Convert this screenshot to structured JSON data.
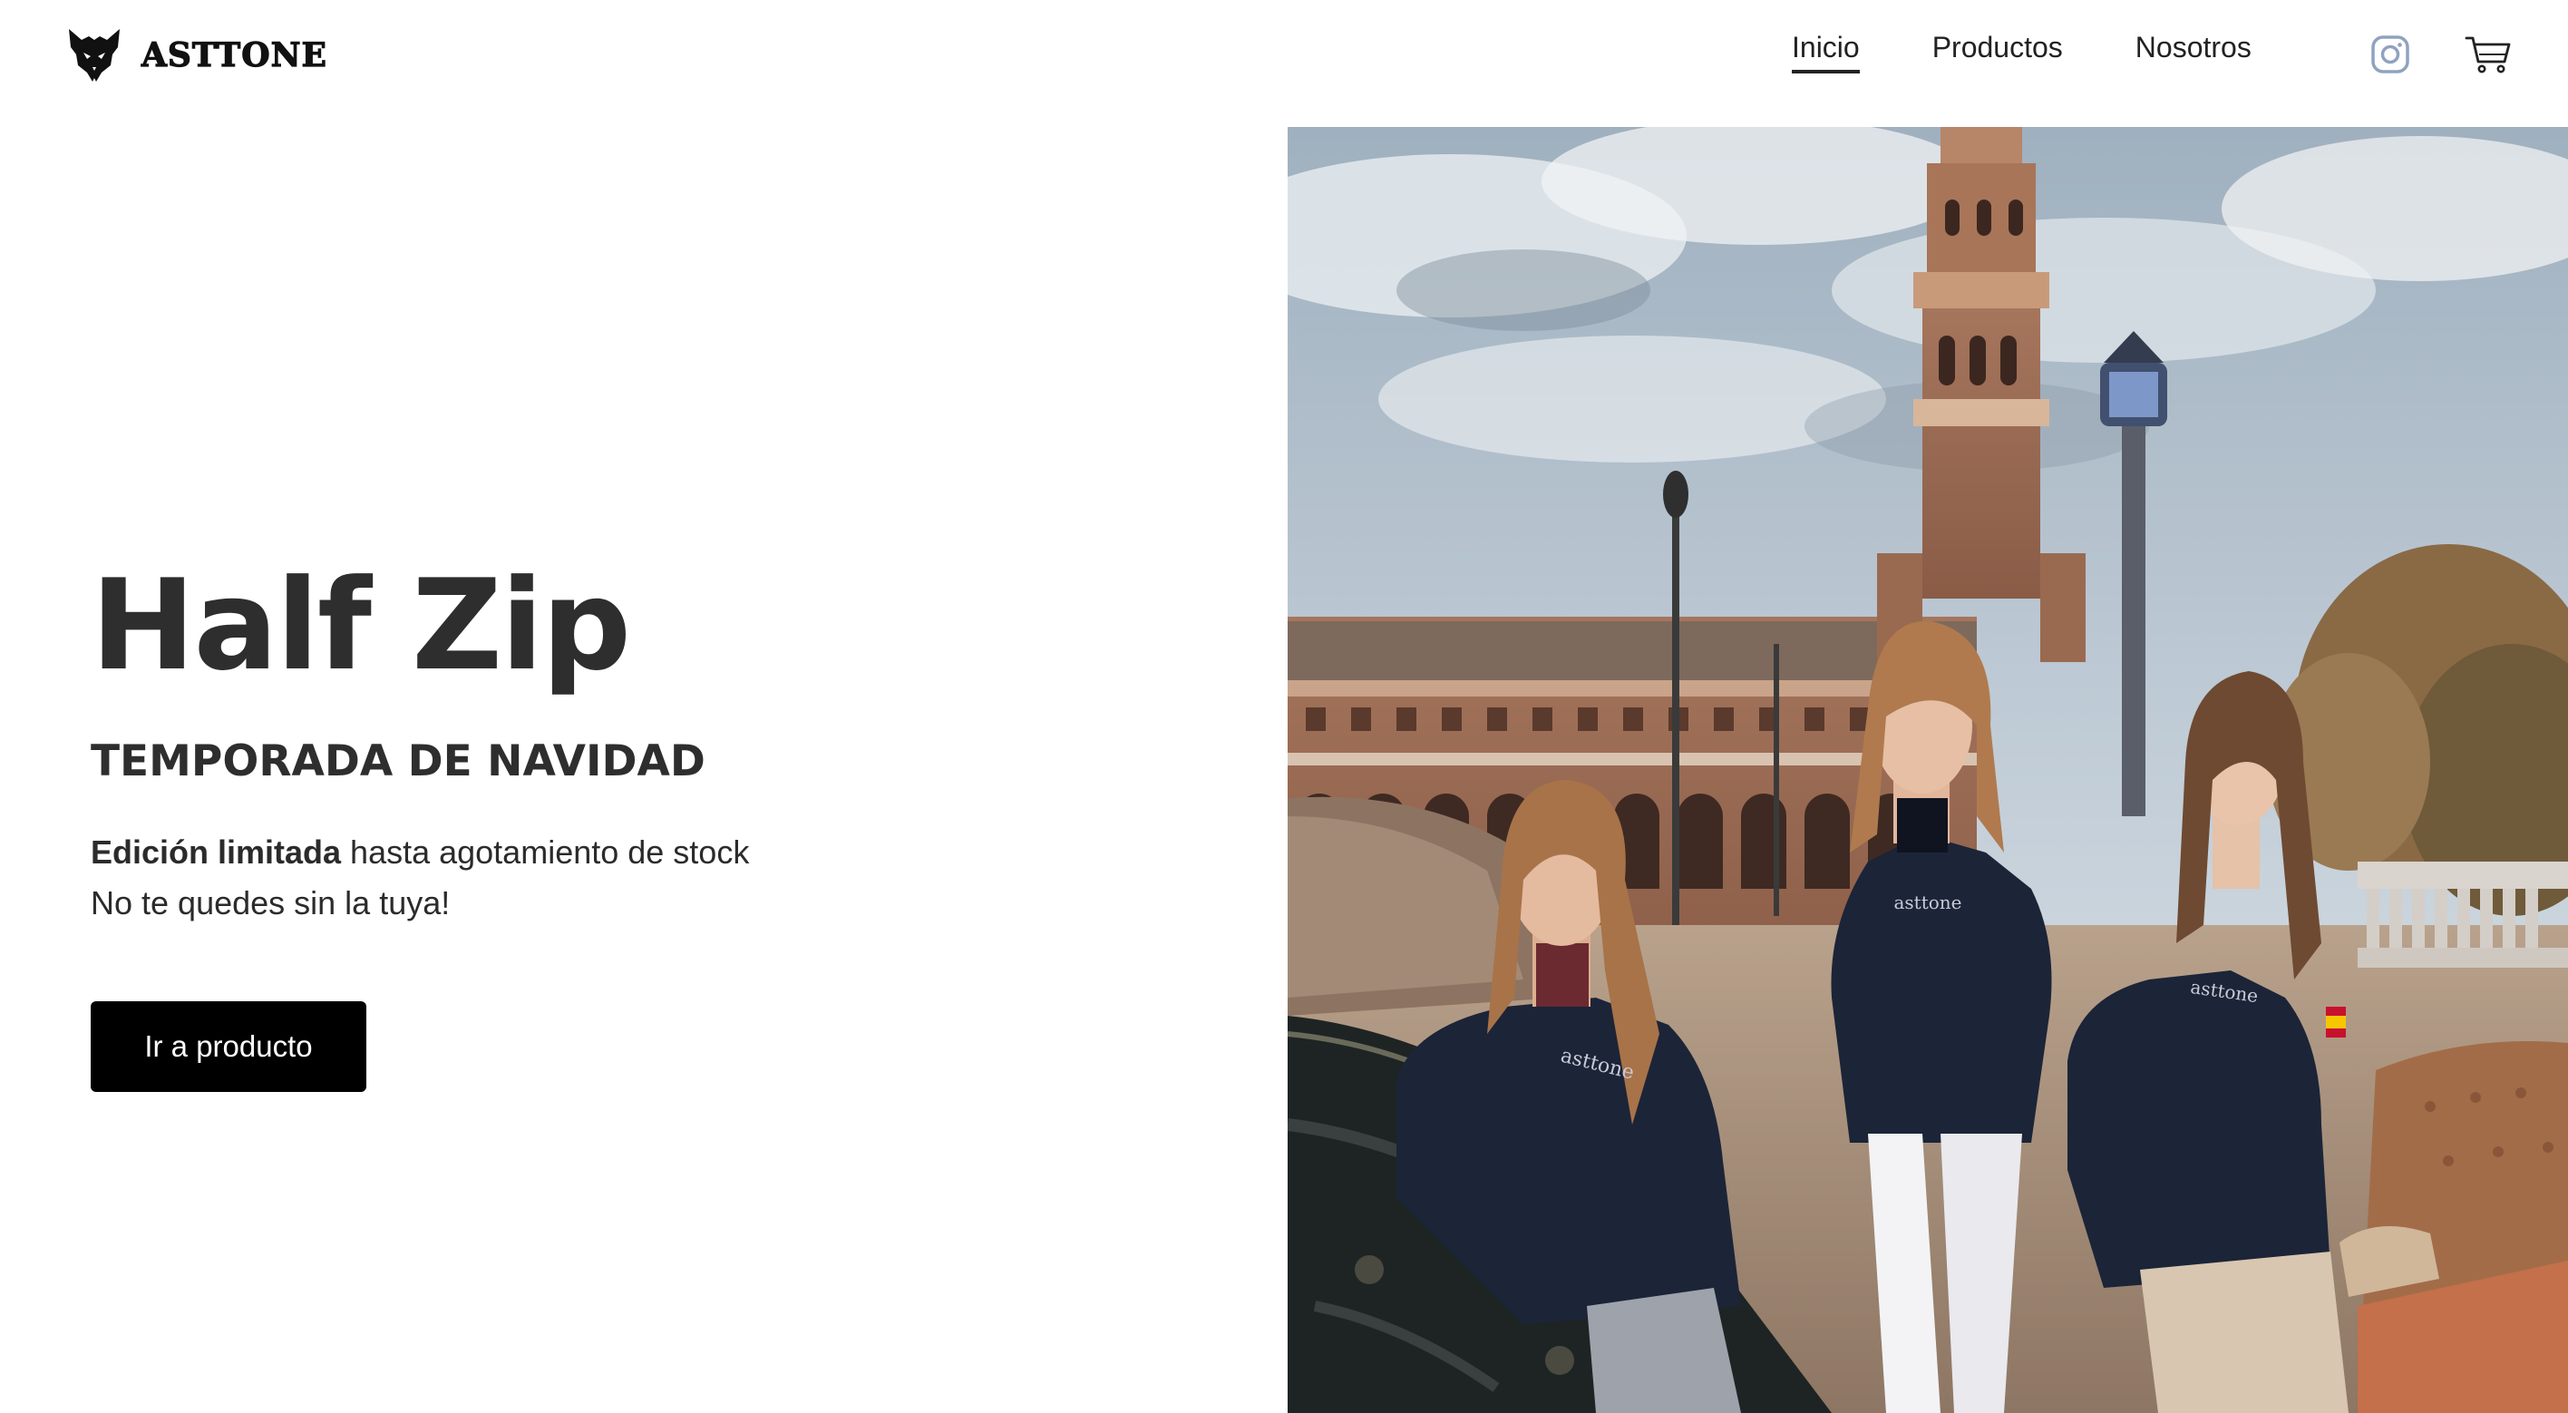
{
  "brand": {
    "name": "ASTTONE",
    "logo_icon": "wolf-head-icon"
  },
  "nav": {
    "items": [
      {
        "label": "Inicio",
        "active": true
      },
      {
        "label": "Productos",
        "active": false
      },
      {
        "label": "Nosotros",
        "active": false
      }
    ],
    "instagram_icon": "instagram-icon",
    "cart_icon": "shopping-cart-icon"
  },
  "hero": {
    "title": "Half Zip",
    "subtitle": "TEMPORADA DE NAVIDAD",
    "desc_bold": "Edición limitada",
    "desc_rest": " hasta agotamiento de stock",
    "desc_line2": "No te quedes sin la tuya!",
    "cta_label": "Ir a producto"
  },
  "photo": {
    "sweater_print": "asttone"
  },
  "colors": {
    "text": "#2e2e2e",
    "button_bg": "#000000",
    "button_text": "#ffffff",
    "instagram_icon": "#8fa3c0",
    "sweater_navy": "#1c2438"
  }
}
